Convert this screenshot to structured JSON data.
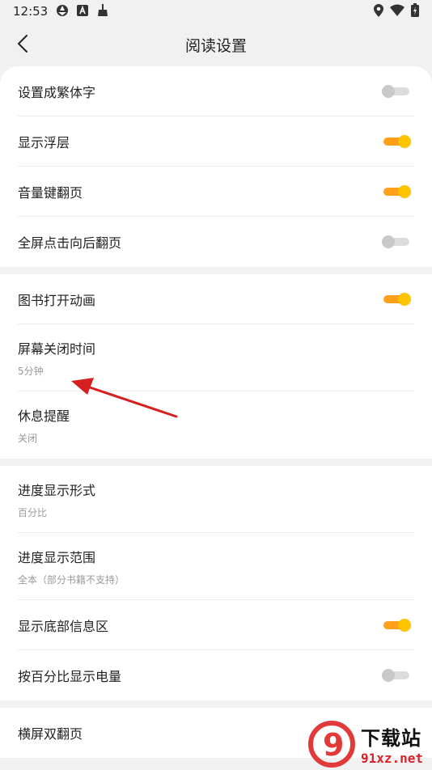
{
  "status_bar": {
    "time": "12:53"
  },
  "header": {
    "title": "阅读设置"
  },
  "groups": [
    {
      "items": [
        {
          "title": "设置成繁体字",
          "toggle": false
        },
        {
          "title": "显示浮层",
          "toggle": true
        },
        {
          "title": "音量键翻页",
          "toggle": true
        },
        {
          "title": "全屏点击向后翻页",
          "toggle": false
        }
      ]
    },
    {
      "items": [
        {
          "title": "图书打开动画",
          "toggle": true
        },
        {
          "title": "屏幕关闭时间",
          "subtitle": "5分钟"
        },
        {
          "title": "休息提醒",
          "subtitle": "关闭"
        }
      ]
    },
    {
      "items": [
        {
          "title": "进度显示形式",
          "subtitle": "百分比"
        },
        {
          "title": "进度显示范围",
          "subtitle": "全本（部分书籍不支持）"
        },
        {
          "title": "显示底部信息区",
          "toggle": true
        },
        {
          "title": "按百分比显示电量",
          "toggle": false
        }
      ]
    },
    {
      "items": [
        {
          "title": "横屏双翻页"
        }
      ]
    }
  ],
  "watermark": {
    "brand": "下载站",
    "domain": "91xz.net",
    "logo_text": "9"
  },
  "colors": {
    "toggle_on_track": "#ff9f1a",
    "toggle_on_knob": "#ffc400",
    "toggle_off": "#c9c9c9",
    "annotation_arrow": "#d62020"
  }
}
